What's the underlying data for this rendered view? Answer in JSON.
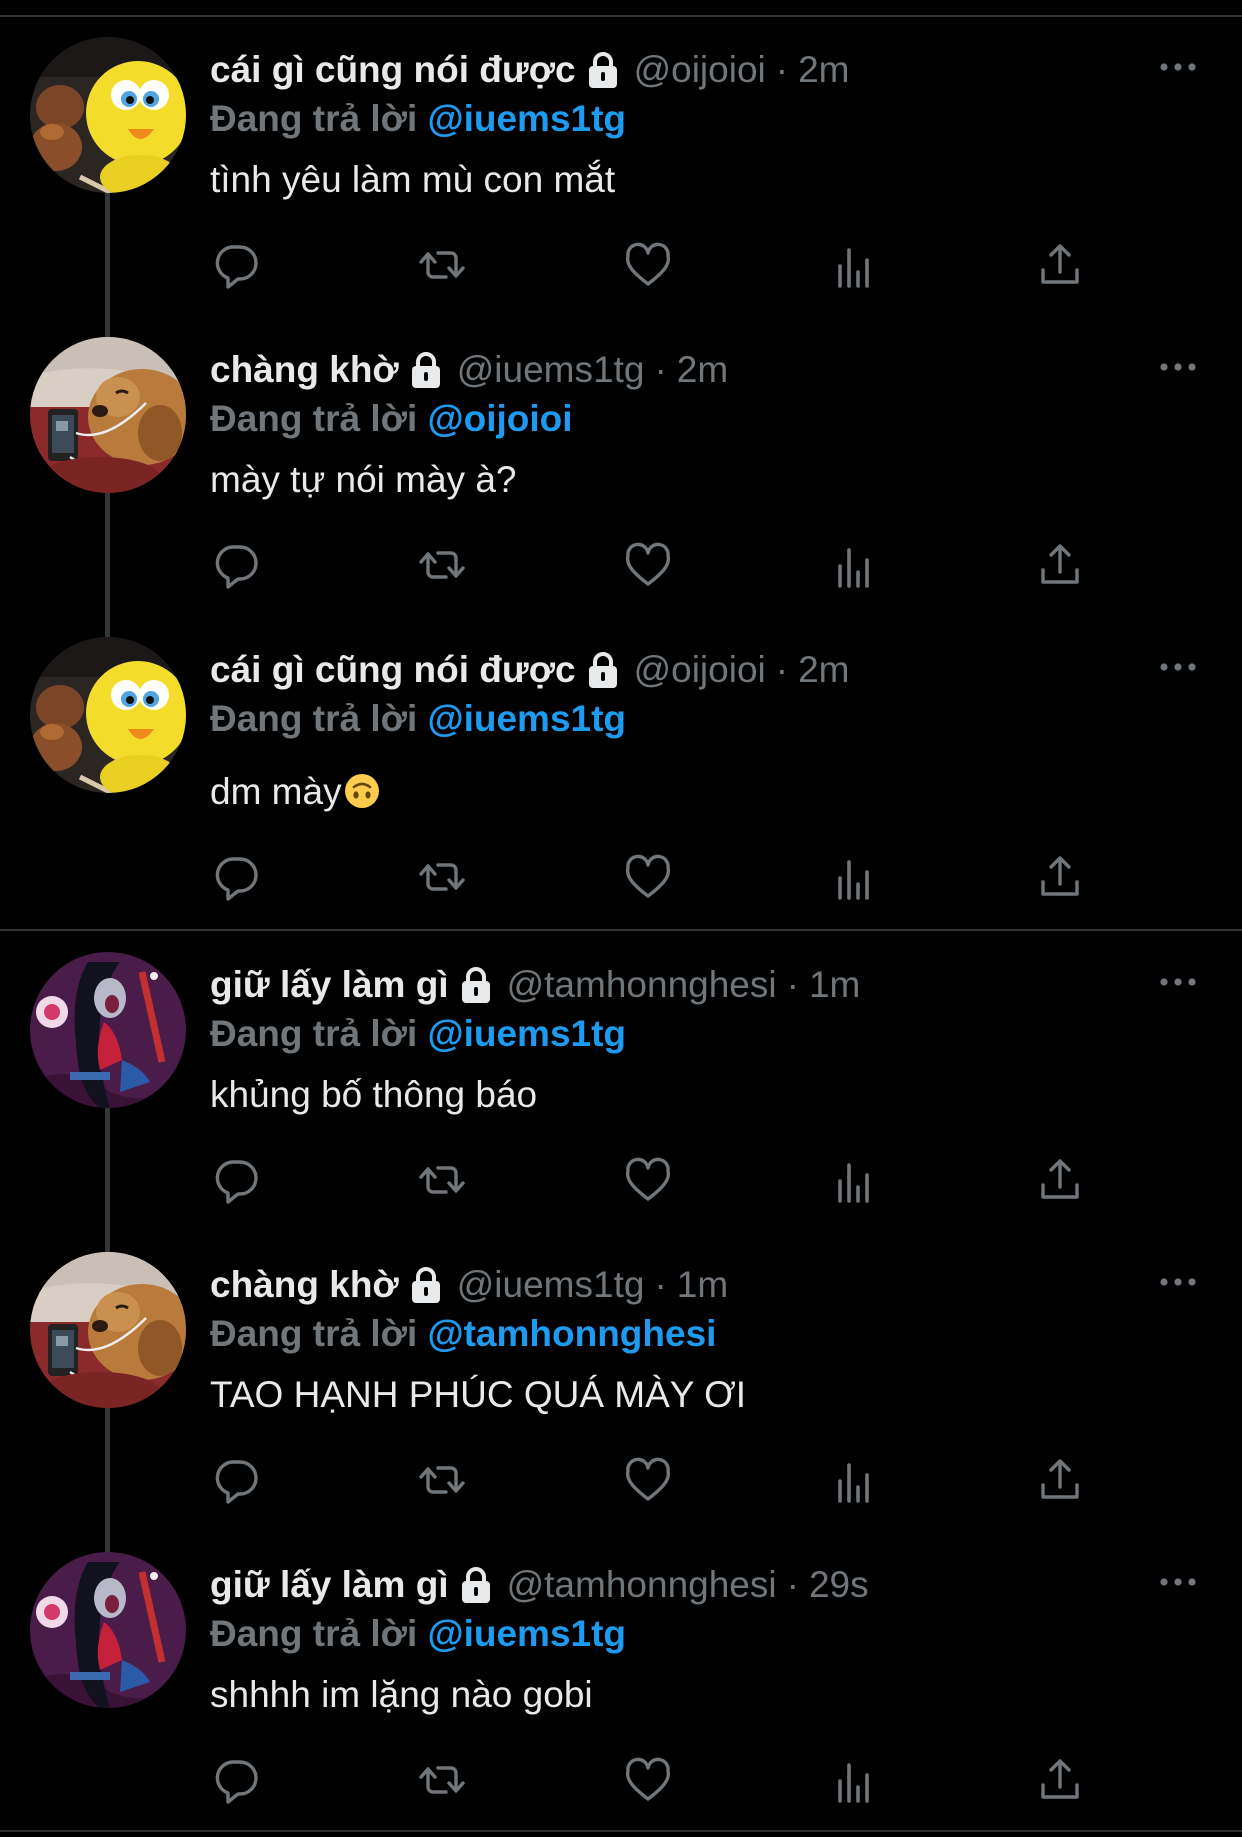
{
  "tweets": [
    {
      "display_name": "cái gì cũng nói được",
      "handle": "@oijoioi",
      "time": "2m",
      "reply_prefix": "Đang trả lời",
      "reply_to": "@iuems1tg",
      "text": "tình yêu làm mù con mắt",
      "avatar": "tweety-bird-avatar"
    },
    {
      "display_name": "chàng khờ",
      "handle": "@iuems1tg",
      "time": "2m",
      "reply_prefix": "Đang trả lời",
      "reply_to": "@oijoioi",
      "text": "mày tự nói mày à?",
      "avatar": "dog-avatar"
    },
    {
      "display_name": "cái gì cũng nói được",
      "handle": "@oijoioi",
      "time": "2m",
      "reply_prefix": "Đang trả lời",
      "reply_to": "@iuems1tg",
      "text": "dm mày",
      "emoji": "upside-down-face",
      "avatar": "tweety-bird-avatar"
    },
    {
      "display_name": "giữ lấy làm gì",
      "handle": "@tamhonnghesi",
      "time": "1m",
      "reply_prefix": "Đang trả lời",
      "reply_to": "@iuems1tg",
      "text": "khủng bố thông báo",
      "avatar": "cartoon-girl-avatar"
    },
    {
      "display_name": "chàng khờ",
      "handle": "@iuems1tg",
      "time": "1m",
      "reply_prefix": "Đang trả lời",
      "reply_to": "@tamhonnghesi",
      "text": "TAO HẠNH PHÚC QUÁ MÀY ƠI",
      "avatar": "dog-avatar"
    },
    {
      "display_name": "giữ lấy làm gì",
      "handle": "@tamhonnghesi",
      "time": "29s",
      "reply_prefix": "Đang trả lời",
      "reply_to": "@iuems1tg",
      "text": "shhhh im lặng nào gobi",
      "avatar": "cartoon-girl-avatar"
    }
  ],
  "separator": "·",
  "icons": {
    "protected": "lock-icon",
    "more": "more-icon",
    "actions": [
      "reply-icon",
      "retweet-icon",
      "like-icon",
      "views-icon",
      "share-icon"
    ]
  },
  "colors": {
    "background": "#000000",
    "text": "#e7e9ea",
    "secondary": "#71767b",
    "link": "#1d9bf0",
    "divider": "#2f3336"
  }
}
